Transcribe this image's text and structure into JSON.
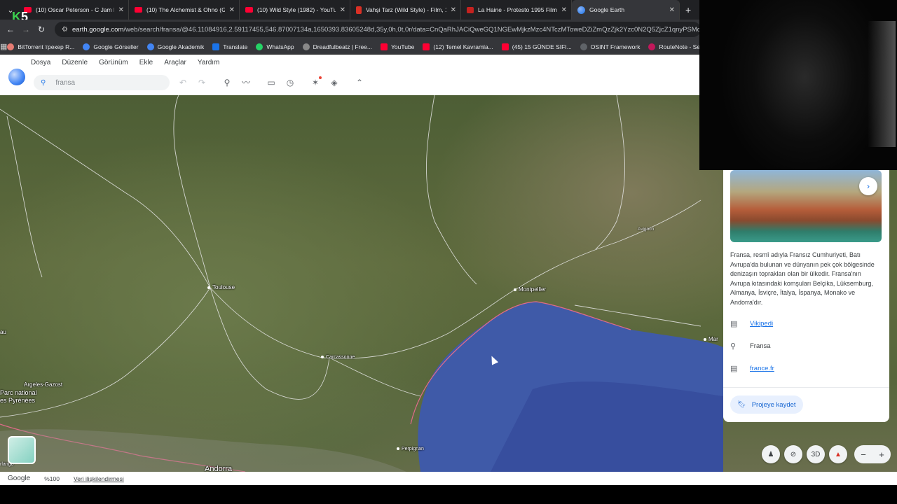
{
  "tabs": [
    {
      "title": "(10) Oscar Peterson - C Jam Blu",
      "icon": "youtube-icon"
    },
    {
      "title": "(10) The Alchemist & Ohno (Ga",
      "icon": "youtube-icon"
    },
    {
      "title": "(10) Wild Style (1982) - YouTub",
      "icon": "youtube-icon"
    },
    {
      "title": "Vahşi Tarz (Wild Style) - Film, 19",
      "icon": "doc-icon"
    },
    {
      "title": "La Haine - Protesto 1995 Filmi",
      "icon": "film-icon"
    },
    {
      "title": "Google Earth",
      "icon": "google-earth-icon",
      "active": true
    }
  ],
  "address": {
    "host": "earth.google.com",
    "path": "/web/search/fransa/@46.11084916,2.59117455,546.87007134a,1650393.83605248d,35y,0h,0t,0r/data=CnQaRhJACiQweGQ1NGEwMjkzMzc4NTczMToweDZiZmQzZjk2Yzc0N2Q5ZjcZ1qnyPSMdR0Ah..."
  },
  "bookmarks": [
    {
      "label": "BitTorrent трекер R...",
      "color": "#e67c73"
    },
    {
      "label": "Google Görseller",
      "color": "#4285f4"
    },
    {
      "label": "Google Akademik",
      "color": "#4285f4"
    },
    {
      "label": "Translate",
      "color": "#1a73e8"
    },
    {
      "label": "WhatsApp",
      "color": "#25d366"
    },
    {
      "label": "Dreadfulbeatz | Free...",
      "color": "#888888"
    },
    {
      "label": "YouTube",
      "color": "#ff0033"
    },
    {
      "label": "(12) Temel Kavramla...",
      "color": "#ff0033"
    },
    {
      "label": "(45) 15 GÜNDE SIFI...",
      "color": "#ff0033"
    },
    {
      "label": "OSINT Framework",
      "color": "#5f6368"
    },
    {
      "label": "RouteNote - Sell Yo...",
      "color": "#c2185b"
    }
  ],
  "menu": [
    "Dosya",
    "Düzenle",
    "Görünüm",
    "Ekle",
    "Araçlar",
    "Yardım"
  ],
  "search": {
    "value": "fransa",
    "placeholder": "fransa"
  },
  "map": {
    "labels": {
      "toulouse": "Toulouse",
      "montpellier": "Montpellier",
      "carcassonne": "Carcassonne",
      "avignon": "Avignon",
      "argeles": "Argeles-Gazost",
      "parc": "Parc national",
      "pyrenees": "es Pyrénées",
      "perpignan": "Perpignan",
      "andorra": "Andorra",
      "marseille": "Mar",
      "au": "au",
      "rlango": "rlango"
    },
    "colors": {
      "sea": "#3f5aa8",
      "roads": "#e8e8e8",
      "borders": "#e06b8a"
    }
  },
  "infocard": {
    "description": "Fransa, resmî adıyla Fransız Cumhuriyeti, Batı Avrupa'da bulunan ve dünyanın pek çok bölgesinde denizaşırı toprakları olan bir ülkedir. Fransa'nın Avrupa kıtasındaki komşuları Belçika, Lüksemburg, Almanya, İsviçre, İtalya, İspanya, Monako ve Andorra'dır.",
    "wiki_label": "Vikipedi",
    "place_label": "Fransa",
    "site_label": "france.fr",
    "save_label": "Projeye kaydet"
  },
  "controls": {
    "three_d": "3D"
  },
  "footer": {
    "brand": "Google",
    "zoom": "%100",
    "data_link": "Veri ilişkilendirmesi"
  },
  "overlay": {
    "watermark_k": "K",
    "watermark_5": "5"
  }
}
